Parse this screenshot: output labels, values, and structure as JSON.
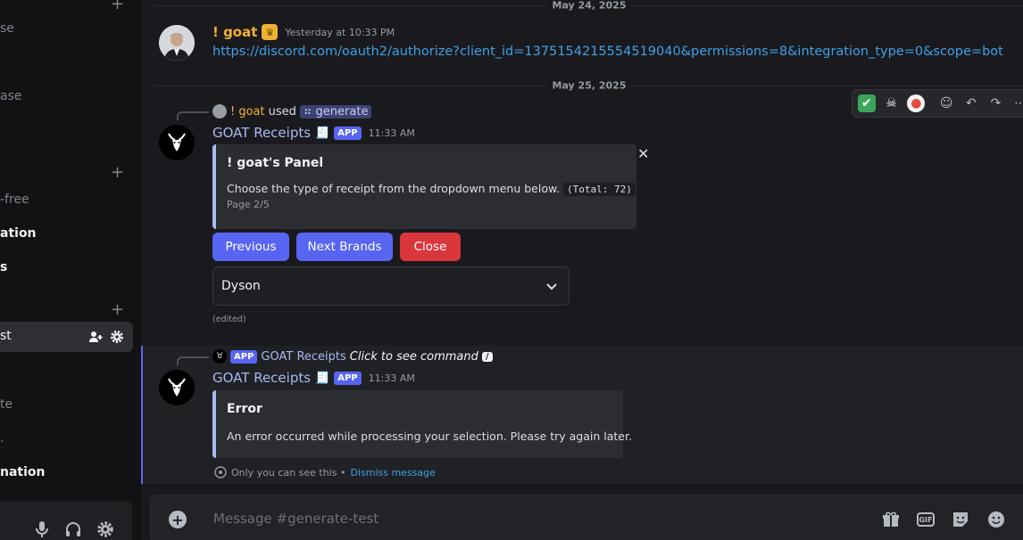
{
  "sidebar": {
    "items": [
      {
        "label": "se",
        "bold": false
      },
      {
        "label": "ase",
        "bold": false
      },
      {
        "label": "-free",
        "bold": false
      },
      {
        "label": "ation",
        "bold": true
      },
      {
        "label": "s",
        "bold": true
      },
      {
        "label": "te",
        "bold": false
      },
      {
        "label": "nation",
        "bold": true
      }
    ],
    "active_item": "st"
  },
  "dividers": [
    "May 24, 2025",
    "May 25, 2025"
  ],
  "message1": {
    "author": "! goat",
    "timestamp": "Yesterday at 10:33 PM",
    "link": "https://discord.com/oauth2/authorize?client_id=1375154215554519040&permissions=8&integration_type=0&scope=bot"
  },
  "message2": {
    "reply_user": "! goat",
    "reply_used": "used",
    "reply_command": "generate",
    "author": "GOAT Receipts",
    "badge": "APP",
    "timestamp": "11:33 AM",
    "embed": {
      "title": "! goat's Panel",
      "description": "Choose the type of receipt from the dropdown menu below.",
      "code": "(Total: 72)",
      "footer": "Page 2/5"
    },
    "buttons": {
      "previous": "Previous",
      "next": "Next Brands",
      "close": "Close"
    },
    "select_value": "Dyson",
    "edited": "(edited)"
  },
  "message3": {
    "reply_badge": "APP",
    "reply_author": "GOAT Receipts",
    "reply_text": "Click to see command",
    "author": "GOAT Receipts",
    "badge": "APP",
    "timestamp": "11:33 AM",
    "embed": {
      "title": "Error",
      "description": "An error occurred while processing your selection. Please try again later."
    },
    "ephemeral_text": "Only you can see this •",
    "dismiss": "Dismiss message"
  },
  "composer": {
    "placeholder": "Message #generate-test"
  },
  "colors": {
    "accent": "#5865f2",
    "danger": "#da373c",
    "link": "#3fa0e7",
    "gold": "#f0b232"
  }
}
